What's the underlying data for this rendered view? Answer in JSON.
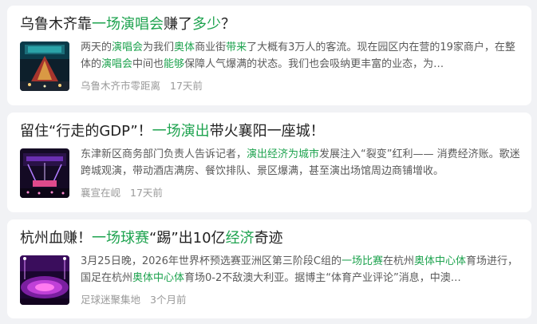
{
  "colors": {
    "highlight": "#1ea34f",
    "title": "#222222",
    "snippet": "#5a5a5a",
    "meta": "#9a9a9a",
    "background": "#f1f2f5"
  },
  "cards": [
    {
      "title": [
        {
          "text": "乌鲁木齐靠",
          "hl": false
        },
        {
          "text": "一场演唱会",
          "hl": true
        },
        {
          "text": "赚了",
          "hl": false
        },
        {
          "text": "多少",
          "hl": true
        },
        {
          "text": "？",
          "hl": false
        }
      ],
      "snippet": [
        {
          "text": "两天的",
          "hl": false
        },
        {
          "text": "演唱会",
          "hl": true
        },
        {
          "text": "为我们",
          "hl": false
        },
        {
          "text": "奥体",
          "hl": true
        },
        {
          "text": "商业街",
          "hl": false
        },
        {
          "text": "带来",
          "hl": true
        },
        {
          "text": "了大概有3万人的客流。现在园区内在营的19家商户，在整体的",
          "hl": false
        },
        {
          "text": "演唱会",
          "hl": true
        },
        {
          "text": "中间也",
          "hl": false
        },
        {
          "text": "能够",
          "hl": true
        },
        {
          "text": "保障人气爆满的状态。我们也会吸纳更丰富的业态，为…",
          "hl": false
        }
      ],
      "source": "乌鲁木齐市零距离",
      "time": "17天前",
      "thumb": "concert-stage-photo"
    },
    {
      "title": [
        {
          "text": "留住“行走的GDP”！",
          "hl": false
        },
        {
          "text": "一场演出",
          "hl": true
        },
        {
          "text": "带火襄阳一座城！",
          "hl": false
        }
      ],
      "snippet": [
        {
          "text": "东津新区商务部门负责人告诉记者，",
          "hl": false
        },
        {
          "text": "演出经济为城市",
          "hl": true
        },
        {
          "text": "发展注入“裂变”红利—— 消费经济账。歌迷跨城观演，带动酒店满房、餐饮排队、景区爆满，甚至演出场馆周边商铺增收。",
          "hl": false
        }
      ],
      "source": "襄宣在岘",
      "time": "17天前",
      "thumb": "concert-lights-photo"
    },
    {
      "title": [
        {
          "text": "杭州血赚！",
          "hl": false
        },
        {
          "text": "一场球赛",
          "hl": true
        },
        {
          "text": "“踢”出10亿",
          "hl": false
        },
        {
          "text": "经济",
          "hl": true
        },
        {
          "text": "奇迹",
          "hl": false
        }
      ],
      "snippet": [
        {
          "text": "3月25日晚，2026年世界杯预选赛亚洲区第三阶段C组的",
          "hl": false
        },
        {
          "text": "一场比赛",
          "hl": true
        },
        {
          "text": "在杭州",
          "hl": false
        },
        {
          "text": "奥体中心体",
          "hl": true
        },
        {
          "text": "育场进行，国足在杭州",
          "hl": false
        },
        {
          "text": "奥体中心体",
          "hl": true
        },
        {
          "text": "育场0-2不敌澳大利亚。据博主“体育产业评论”消息，中澳…",
          "hl": false
        }
      ],
      "source": "足球迷聚集地",
      "time": "3个月前",
      "thumb": "stadium-night-photo"
    }
  ]
}
